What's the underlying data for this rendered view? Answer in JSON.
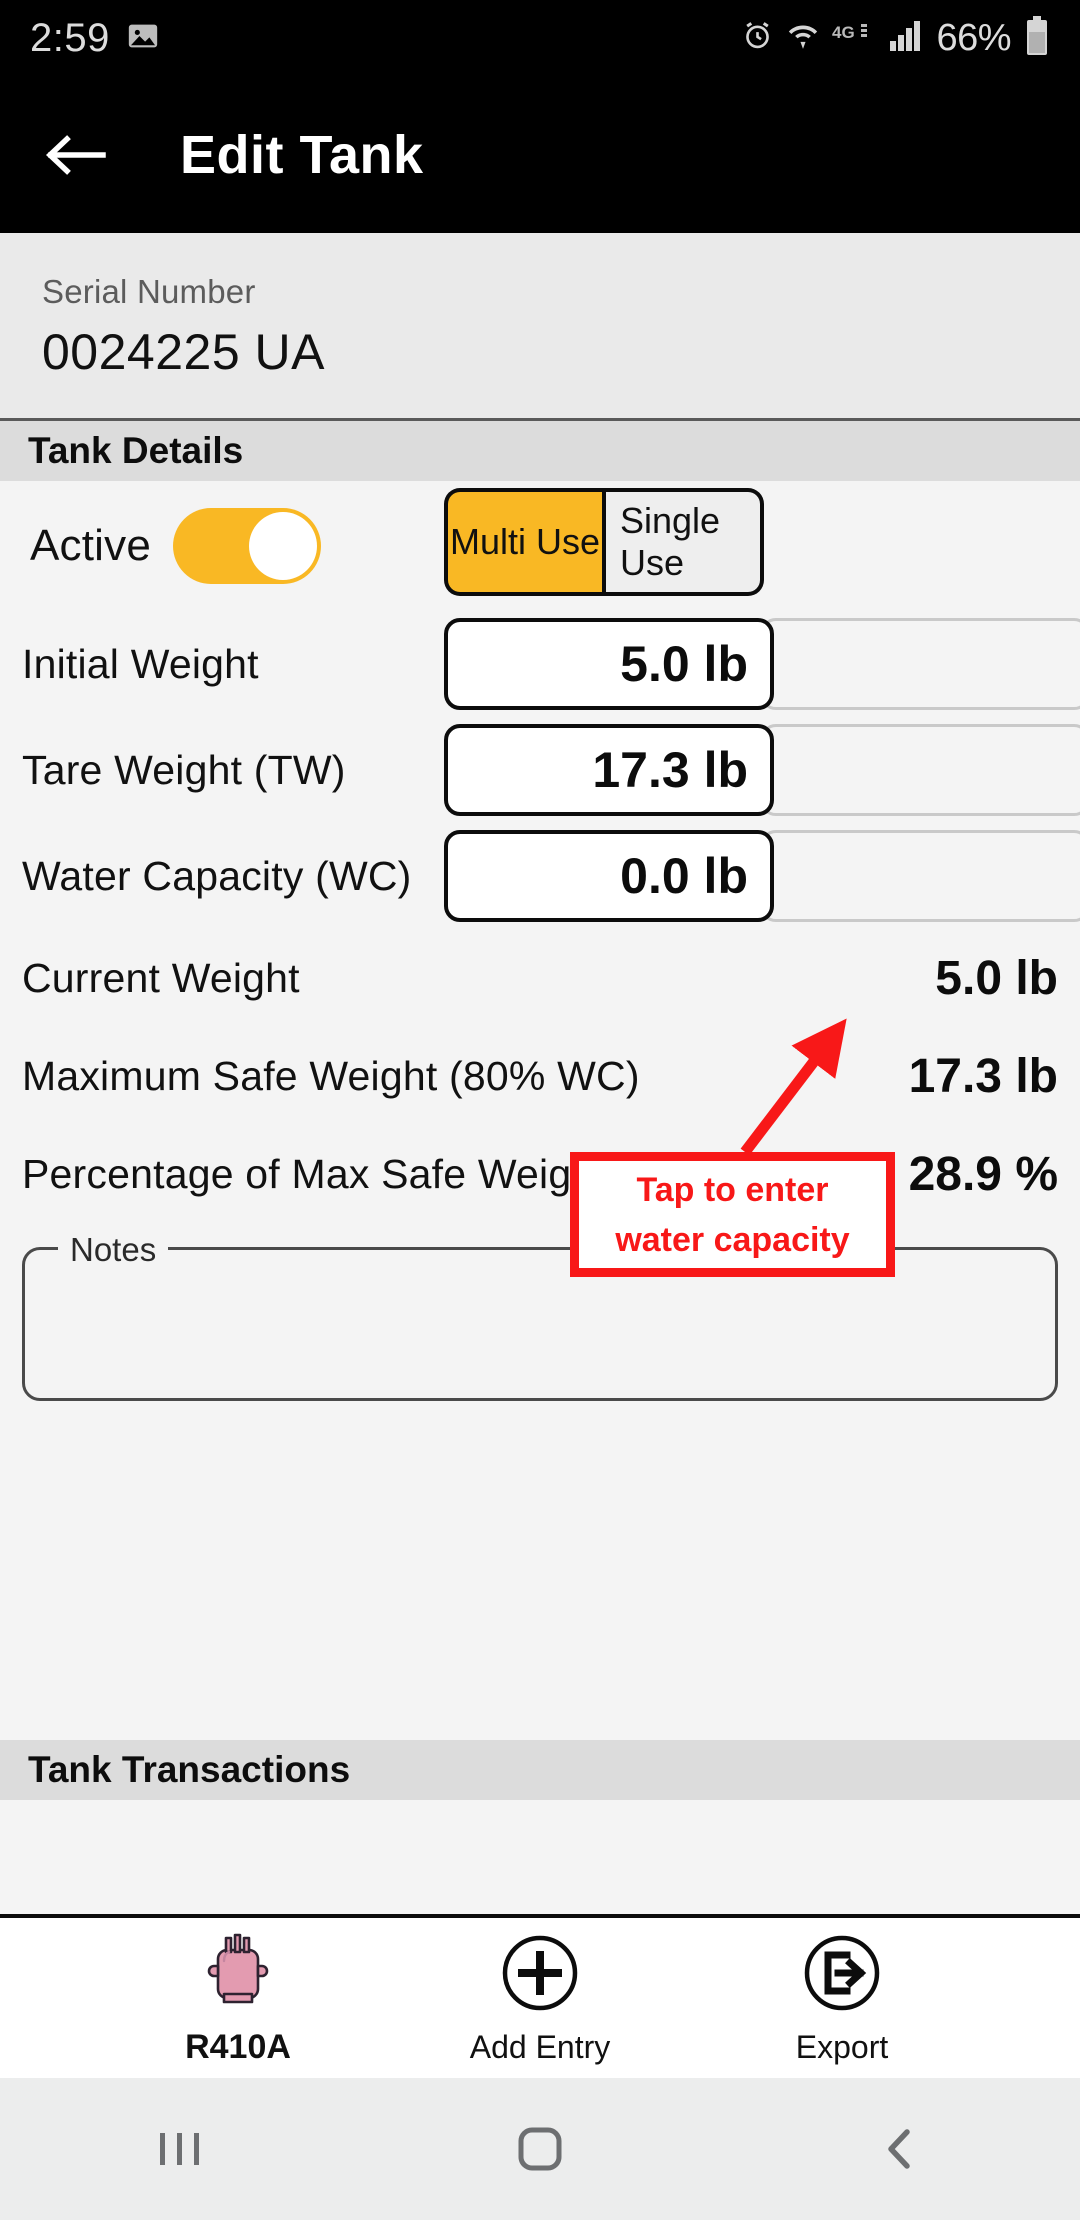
{
  "status_bar": {
    "clock": "2:59",
    "battery_percent": "66%",
    "icons": [
      "image-icon",
      "alarm-icon",
      "wifi-icon",
      "network-4g-icon",
      "signal-bars-icon",
      "battery-icon"
    ]
  },
  "app_bar": {
    "back_icon": "back-arrow-icon",
    "title": "Edit Tank"
  },
  "serial": {
    "label": "Serial Number",
    "value": "0024225 UA"
  },
  "sections": {
    "tank_details": "Tank Details",
    "tank_transactions": "Tank Transactions"
  },
  "form": {
    "active": {
      "label": "Active",
      "toggle_on": true
    },
    "use_mode": {
      "multi": "Multi Use",
      "single": "Single Use",
      "selected": "Multi Use"
    },
    "fields": [
      {
        "label": "Initial Weight",
        "value": "5.0 lb"
      },
      {
        "label": "Tare Weight (TW)",
        "value": "17.3 lb"
      },
      {
        "label": "Water Capacity (WC)",
        "value": "0.0 lb"
      }
    ],
    "readouts": [
      {
        "label": "Current Weight",
        "value": "5.0 lb"
      },
      {
        "label": "Maximum Safe Weight (80% WC)",
        "value": "17.3 lb"
      },
      {
        "label": "Percentage of Max Safe Weight",
        "value": "28.9 %"
      }
    ],
    "notes": {
      "legend": "Notes",
      "value": "",
      "placeholder": ""
    }
  },
  "annotation": {
    "line1": "Tap to enter",
    "line2": "water capacity",
    "color": "#F81818"
  },
  "action_bar": [
    {
      "label": "R410A",
      "icon": "refrigerant-tank-icon"
    },
    {
      "label": "Add Entry",
      "icon": "plus-circle-icon"
    },
    {
      "label": "Export",
      "icon": "export-circle-icon"
    }
  ],
  "nav_bar": [
    {
      "icon": "recents-icon"
    },
    {
      "icon": "home-icon"
    },
    {
      "icon": "back-icon"
    }
  ],
  "colors": {
    "accent_amber": "#F9B824",
    "annotation_red": "#F81818",
    "app_bar": "#000000",
    "page_bg": "#F4F4F4",
    "section_header_bg": "#DCDCDC"
  }
}
